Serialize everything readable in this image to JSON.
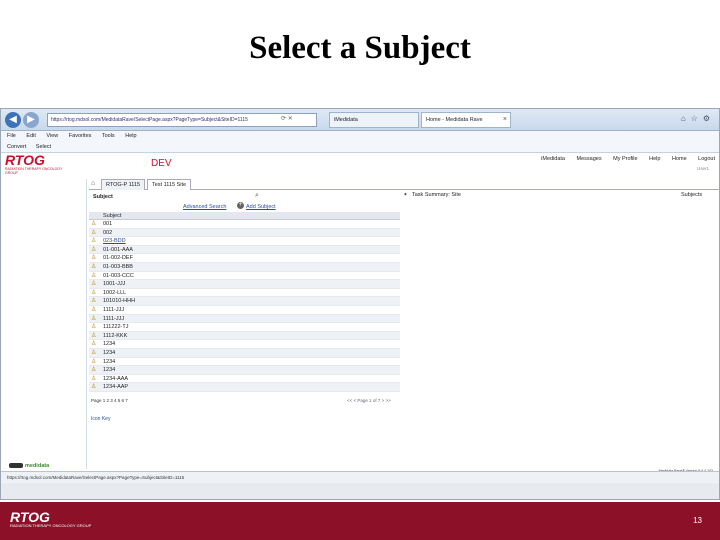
{
  "slide": {
    "title": "Select a Subject",
    "page_number": "13"
  },
  "browser": {
    "url": "https://rtog.mdsol.com/MedidataRave/SelectPage.aspx?PageType=Subject&SiteID=1115",
    "tabs": [
      {
        "label": "iMedidata"
      },
      {
        "label": "Home - Medidata Rave"
      }
    ],
    "menu": [
      "File",
      "Edit",
      "View",
      "Favorites",
      "Tools",
      "Help"
    ],
    "favorites": [
      "Convert",
      "Select"
    ],
    "status_url": "https://rtog.mdsol.com/MedidataRave/SelectPage.aspx?PageType=Subject&SiteID=1115"
  },
  "header": {
    "logo_main": "RTOG",
    "logo_sub": "Radiation Therapy Oncology Group",
    "env": "DEV",
    "links": [
      "iMedidata",
      "Messages",
      "My Profile",
      "Help",
      "Home",
      "Logout"
    ],
    "user": "User1"
  },
  "app_tabs": [
    {
      "label": "RTOG-P 1115"
    },
    {
      "label": "Test 1115 Site"
    }
  ],
  "search": {
    "label": "Subject",
    "advanced_search": "Advanced Search",
    "add_subject": "Add Subject"
  },
  "task_summary": {
    "label": "Task Summary: Site",
    "right_label": "Subjects"
  },
  "table": {
    "header": "Subject",
    "rows": [
      "001",
      "002",
      "023-BDD",
      "01-001-AAA",
      "01-002-DEF",
      "01-003-BBB",
      "01-003-CCC",
      "1001-JJJ",
      "1002-LLL",
      "101010-HHH",
      "1111-JJJ",
      "1111-JJJ",
      "111222-TJ",
      "1112-KKK",
      "1234",
      "1234",
      "1234",
      "1234",
      "1234-AAA",
      "1234-AAP"
    ]
  },
  "pager": {
    "text": "Page 1 2 3 4 5 6 7",
    "nav": "<< < Page 1 of 7 > >>"
  },
  "icon_key": "Icon Key",
  "footer": {
    "medidata": "medidata",
    "version_line1": "Medidata Rave® Version 5.6.4.103",
    "version_line2": "Copyright © 1999-2012 Medidata Solutions, Inc."
  }
}
